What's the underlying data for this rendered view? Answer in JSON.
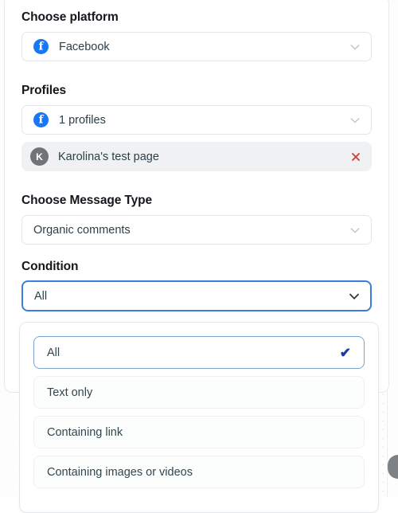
{
  "platform": {
    "label": "Choose platform",
    "selected": "Facebook",
    "icon": "facebook-icon",
    "chevron": "chevron-down-icon"
  },
  "profiles": {
    "label": "Profiles",
    "selected": "1 profiles",
    "icon": "facebook-icon",
    "chevron": "chevron-down-icon",
    "chips": [
      {
        "name": "Karolina's test page",
        "avatar_initial": "K",
        "remove_icon": "close-x-icon"
      }
    ]
  },
  "message_type": {
    "label": "Choose Message Type",
    "selected": "Organic comments",
    "chevron": "chevron-down-icon"
  },
  "condition": {
    "label": "Condition",
    "selected": "All",
    "chevron": "chevron-down-icon",
    "focused": true,
    "options": [
      {
        "label": "All",
        "selected": true,
        "check_icon": "check-icon"
      },
      {
        "label": "Text only",
        "selected": false
      },
      {
        "label": "Containing link",
        "selected": false
      },
      {
        "label": "Containing images or videos",
        "selected": false
      }
    ]
  },
  "colors": {
    "facebook_blue": "#1877f2",
    "focus_border_blue": "#3b7ddd",
    "check_blue": "#1a3a9c",
    "remove_red": "#cf4040",
    "heading_text": "#14181c",
    "body_text": "#2d4048",
    "chip_background": "#f0f1f3",
    "avatar_background": "#6f7478"
  },
  "scrollbar": {
    "name": "vertical-scrollbar-thumb"
  }
}
